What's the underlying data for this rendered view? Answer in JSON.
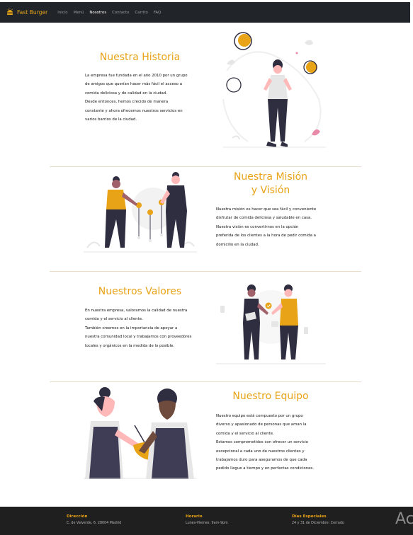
{
  "nav": {
    "brand": "Fast Burger",
    "links": [
      "Inicio",
      "Menú",
      "Nosotros",
      "Contacto",
      "Carrito",
      "FAQ"
    ],
    "active": "Nosotros"
  },
  "historia": {
    "title": "Nuestra Historia",
    "lines": [
      "La empresa fue fundada en el año 2010 por un grupo",
      "de amigos que querían hacer más fácil el acceso a",
      "comida deliciosa y de calidad en la ciudad.",
      " Desde entonces, hemos crecido de manera",
      "constante y ahora ofrecemos nuestros servicios en",
      "varios barrios de la ciudad."
    ]
  },
  "mision": {
    "title_line1": "Nuestra Misión",
    "title_line2": "y Visión",
    "lines": [
      "Nuestra misión es hacer que sea fácil y conveniente",
      "disfrutar de comida deliciosa y saludable en casa.",
      " Nuestra visión es convertirnos en la opción",
      "preferida de los clientes a la hora de pedir comida a",
      "domicilio en la ciudad."
    ]
  },
  "valores": {
    "title": "Nuestros Valores",
    "lines": [
      "En nuestra empresa, valoramos la calidad de nuestra",
      "comida y el servicio al cliente.",
      " También creemos en la importancia de apoyar a",
      "nuestra comunidad local y trabajamos con proveedores",
      "locales y orgánicos en la medida de lo posible."
    ]
  },
  "equipo": {
    "title": "Nuestro Equipo",
    "lines": [
      "Nuestro equipo está compuesto por un grupo",
      "diverso y apasionado de personas que aman la",
      "comida y el servicio al cliente.",
      " Estamos comprometidos con ofrecer un servicio",
      "excepcional a cada uno de nuestros clientes y",
      "trabajamos duro para aseguramos de que cada",
      "pedido llegue a tiempo y en perfectas condiciones."
    ]
  },
  "footer": {
    "direccion_label": "Dirección",
    "direccion_value": "C. de Valverde, 6, 28004 Madrid",
    "horario_label": "Horario",
    "horario_value": "Lunes-Viernes: 9am-9pm",
    "dias_label": "Días Especiales",
    "dias_value": "24 y 31 de Diciembre: Cerrado"
  },
  "watermark": "Ac",
  "colors": {
    "accent": "#e8a317",
    "dark": "#212529",
    "figure_dark": "#2f2e41",
    "footer_bg": "#1f1f1f"
  }
}
